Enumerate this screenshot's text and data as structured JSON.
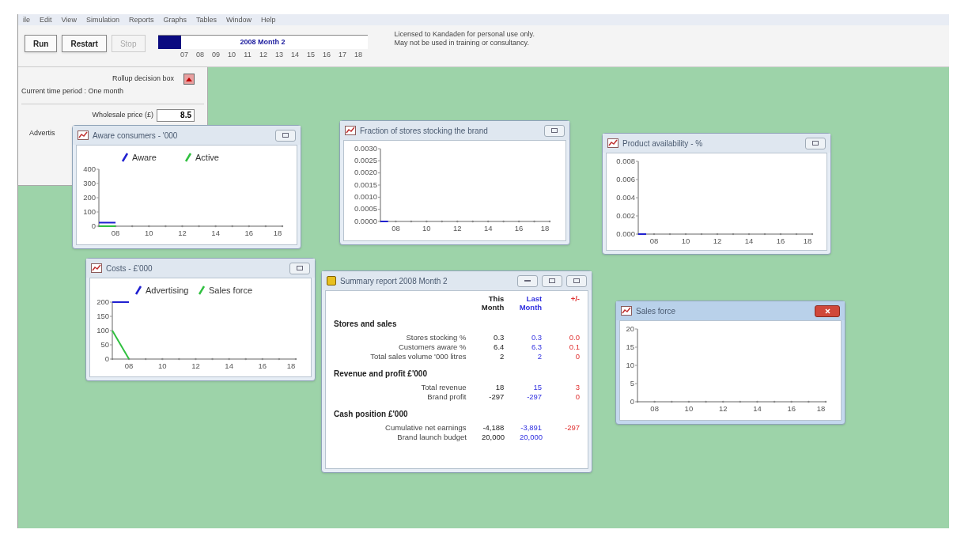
{
  "menu": [
    "ile",
    "Edit",
    "View",
    "Simulation",
    "Reports",
    "Graphs",
    "Tables",
    "Window",
    "Help"
  ],
  "toolbar": {
    "buttons": [
      {
        "label": "Run",
        "disabled": false
      },
      {
        "label": "Restart",
        "disabled": false
      },
      {
        "label": "Stop",
        "disabled": true
      }
    ],
    "timeline": {
      "title": "2008 Month 2",
      "level": 0.11,
      "ticks": [
        "07",
        "08",
        "09",
        "10",
        "11",
        "12",
        "13",
        "14",
        "15",
        "16",
        "17",
        "18"
      ]
    },
    "license": [
      "Licensed to Kandaden for personal use only.",
      "May not be used in training or consultancy."
    ]
  },
  "decision_box": {
    "rollup_label": "Rollup decision box",
    "period": "Current time period : One month",
    "fields": [
      {
        "label": "Wholesale price (£)",
        "value": "8.5"
      }
    ],
    "partial_label": "Advertis"
  },
  "windows": [
    {
      "kind": "graph",
      "title": "Aware consumers - '000",
      "active": false,
      "chart_data": {
        "type": "line",
        "legend": "top",
        "x": [
          7,
          8
        ],
        "series": [
          {
            "name": "Aware",
            "color": "#2020d0",
            "values": [
              25,
              25
            ]
          },
          {
            "name": "Active",
            "color": "#30c040",
            "values": [
              0,
              0
            ]
          }
        ],
        "xlim": [
          7,
          18
        ],
        "ylim": [
          0,
          400
        ],
        "yticks": [
          0,
          100,
          200,
          300,
          400
        ],
        "xticks": [
          {
            "value": 8,
            "label": "08"
          },
          {
            "value": 10,
            "label": "10"
          },
          {
            "value": 12,
            "label": "12"
          },
          {
            "value": 14,
            "label": "14"
          },
          {
            "value": 16,
            "label": "16"
          },
          {
            "value": 18,
            "label": "18"
          }
        ]
      }
    },
    {
      "kind": "graph",
      "title": "Fraction of stores stocking the brand",
      "active": false,
      "chart_data": {
        "type": "line",
        "x": [
          7,
          7.5
        ],
        "series": [
          {
            "color": "#2020d0",
            "values": [
              0,
              0
            ]
          }
        ],
        "xlim": [
          7,
          18
        ],
        "ylim": [
          0,
          0.003
        ],
        "yticks": [
          {
            "value": 0,
            "label": "0.0000"
          },
          {
            "value": 0.0005,
            "label": "0.0005"
          },
          {
            "value": 0.001,
            "label": "0.0010"
          },
          {
            "value": 0.0015,
            "label": "0.0015"
          },
          {
            "value": 0.002,
            "label": "0.0020"
          },
          {
            "value": 0.0025,
            "label": "0.0025"
          },
          {
            "value": 0.003,
            "label": "0.0030"
          }
        ],
        "xticks": [
          {
            "value": 8,
            "label": "08"
          },
          {
            "value": 10,
            "label": "10"
          },
          {
            "value": 12,
            "label": "12"
          },
          {
            "value": 14,
            "label": "14"
          },
          {
            "value": 16,
            "label": "16"
          },
          {
            "value": 18,
            "label": "18"
          }
        ]
      }
    },
    {
      "kind": "graph",
      "title": "Product availability - %",
      "active": false,
      "chart_data": {
        "type": "line",
        "x": [
          7,
          7.5
        ],
        "series": [
          {
            "color": "#2020d0",
            "values": [
              0,
              0
            ]
          }
        ],
        "xlim": [
          7,
          18
        ],
        "ylim": [
          0,
          0.008
        ],
        "yticks": [
          {
            "value": 0,
            "label": "0.000"
          },
          {
            "value": 0.002,
            "label": "0.002"
          },
          {
            "value": 0.004,
            "label": "0.004"
          },
          {
            "value": 0.006,
            "label": "0.006"
          },
          {
            "value": 0.008,
            "label": "0.008"
          }
        ],
        "xticks": [
          {
            "value": 8,
            "label": "08"
          },
          {
            "value": 10,
            "label": "10"
          },
          {
            "value": 12,
            "label": "12"
          },
          {
            "value": 14,
            "label": "14"
          },
          {
            "value": 16,
            "label": "16"
          },
          {
            "value": 18,
            "label": "18"
          }
        ]
      }
    },
    {
      "kind": "graph",
      "title": "Costs - £'000",
      "active": false,
      "chart_data": {
        "type": "line",
        "legend": "top",
        "x": [
          7,
          8
        ],
        "series": [
          {
            "name": "Advertising",
            "color": "#2020d0",
            "values": [
              200,
              200
            ]
          },
          {
            "name": "Sales force",
            "color": "#30c040",
            "values": [
              100,
              0
            ]
          }
        ],
        "xlim": [
          7,
          18
        ],
        "ylim": [
          0,
          200
        ],
        "yticks": [
          0,
          50,
          100,
          150,
          200
        ],
        "xticks": [
          {
            "value": 8,
            "label": "08"
          },
          {
            "value": 10,
            "label": "10"
          },
          {
            "value": 12,
            "label": "12"
          },
          {
            "value": 14,
            "label": "14"
          },
          {
            "value": 16,
            "label": "16"
          },
          {
            "value": 18,
            "label": "18"
          }
        ]
      }
    },
    {
      "kind": "report",
      "title": "Summary report 2008 Month 2",
      "active": false,
      "columns": [
        "This Month",
        "Last Month",
        "+/-"
      ],
      "rows": [
        {
          "kind": "section",
          "label": "Stores and sales"
        },
        {
          "kind": "row",
          "label": "Stores stocking %",
          "values": [
            "0.3",
            "0.3",
            "0.0"
          ]
        },
        {
          "kind": "row",
          "label": "Customers aware %",
          "values": [
            "6.4",
            "6.3",
            "0.1"
          ]
        },
        {
          "kind": "row",
          "label": "Total sales volume '000 litres",
          "values": [
            "2",
            "2",
            "0"
          ]
        },
        {
          "kind": "section",
          "label": "Revenue and profit £'000"
        },
        {
          "kind": "row",
          "label": "Total revenue",
          "values": [
            "18",
            "15",
            "3"
          ]
        },
        {
          "kind": "row",
          "label": "Brand profit",
          "values": [
            "-297",
            "-297",
            "0"
          ]
        },
        {
          "kind": "section",
          "label": "Cash position £'000"
        },
        {
          "kind": "row",
          "label": "Cumulative net earnings",
          "values": [
            "-4,188",
            "-3,891",
            "-297"
          ]
        },
        {
          "kind": "row",
          "label": "Brand launch budget",
          "values": [
            "20,000",
            "20,000"
          ]
        }
      ]
    },
    {
      "kind": "graph",
      "title": "Sales force",
      "active": true,
      "chart_data": {
        "type": "line",
        "xlim": [
          7,
          18
        ],
        "ylim": [
          0,
          20
        ],
        "yticks": [
          0,
          5,
          10,
          15,
          20
        ],
        "xticks": [
          {
            "value": 8,
            "label": "08"
          },
          {
            "value": 10,
            "label": "10"
          },
          {
            "value": 12,
            "label": "12"
          },
          {
            "value": 14,
            "label": "14"
          },
          {
            "value": 16,
            "label": "16"
          },
          {
            "value": 18,
            "label": "18"
          }
        ]
      }
    }
  ]
}
